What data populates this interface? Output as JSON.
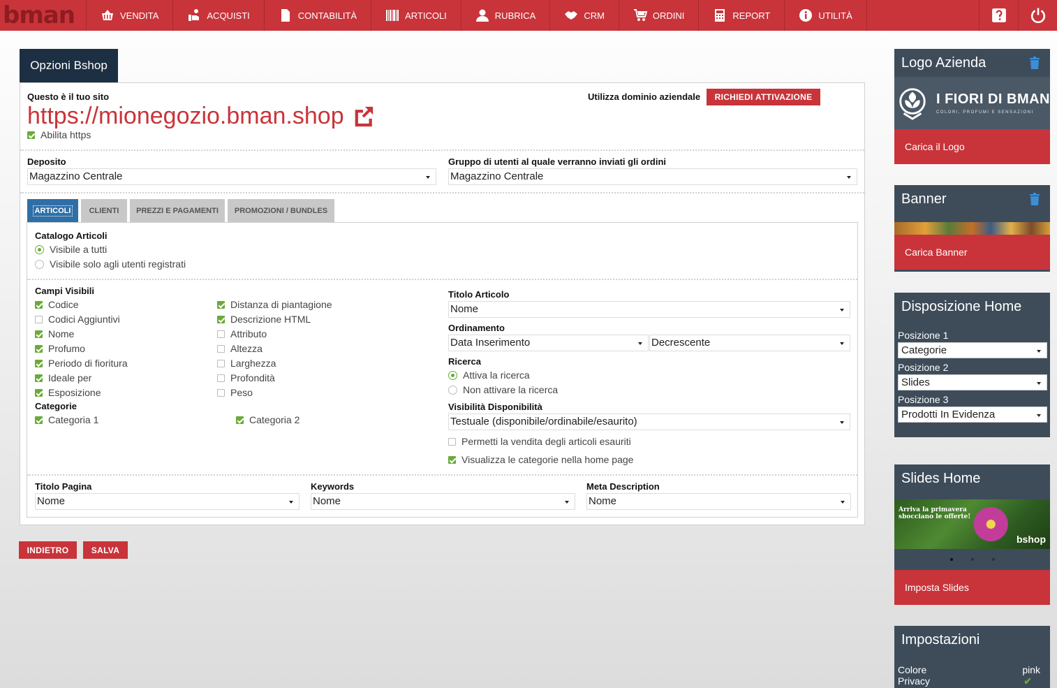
{
  "nav": {
    "logo": "bman",
    "items": [
      {
        "label": "VENDITA",
        "icon": "basket-icon"
      },
      {
        "label": "ACQUISTI",
        "icon": "hand-coin-icon"
      },
      {
        "label": "CONTABILITÀ",
        "icon": "document-icon"
      },
      {
        "label": "ARTICOLI",
        "icon": "barcode-icon"
      },
      {
        "label": "RUBRICA",
        "icon": "user-icon"
      },
      {
        "label": "CRM",
        "icon": "handshake-icon"
      },
      {
        "label": "ORDINI",
        "icon": "cart-icon"
      },
      {
        "label": "REPORT",
        "icon": "calculator-icon"
      },
      {
        "label": "UTILITÀ",
        "icon": "info-icon"
      }
    ]
  },
  "page": {
    "title": "Opzioni Bshop",
    "site_label": "Questo è il tuo sito",
    "site_url": "https://mionegozio.bman.shop",
    "https_label": "Abilita https",
    "https_enabled": true,
    "domain_label": "Utilizza dominio aziendale",
    "domain_button": "RICHIEDI ATTIVAZIONE",
    "deposit_label": "Deposito",
    "deposit_value": "Magazzino Centrale",
    "group_label": "Gruppo di utenti al quale verranno inviati gli ordini",
    "group_value": "Magazzino Centrale"
  },
  "tabs": [
    "ARTICOLI",
    "CLIENTI",
    "PREZZI E PAGAMENTI",
    "PROMOZIONI / BUNDLES"
  ],
  "articoli": {
    "catalog_label": "Catalogo Articoli",
    "catalog_options": [
      "Visibile a tutti",
      "Visibile solo agli utenti registrati"
    ],
    "catalog_selected": 0,
    "fields_label": "Campi Visibili",
    "fields_col1": [
      {
        "label": "Codice",
        "checked": true
      },
      {
        "label": "Codici Aggiuntivi",
        "checked": false
      },
      {
        "label": "Nome",
        "checked": true
      },
      {
        "label": "Profumo",
        "checked": true
      },
      {
        "label": "Periodo di fioritura",
        "checked": true
      },
      {
        "label": "Ideale per",
        "checked": true
      },
      {
        "label": "Esposizione",
        "checked": true
      }
    ],
    "fields_col2": [
      {
        "label": "Distanza di piantagione",
        "checked": true
      },
      {
        "label": "Descrizione HTML",
        "checked": true
      },
      {
        "label": "Attributo",
        "checked": false
      },
      {
        "label": "Altezza",
        "checked": false
      },
      {
        "label": "Larghezza",
        "checked": false
      },
      {
        "label": "Profondità",
        "checked": false
      },
      {
        "label": "Peso",
        "checked": false
      }
    ],
    "categories_label": "Categorie",
    "categories": [
      {
        "label": "Categoria 1",
        "checked": true
      },
      {
        "label": "Categoria 2",
        "checked": true
      }
    ],
    "title_label": "Titolo Articolo",
    "title_value": "Nome",
    "order_label": "Ordinamento",
    "order_field": "Data Inserimento",
    "order_dir": "Decrescente",
    "search_label": "Ricerca",
    "search_options": [
      "Attiva la ricerca",
      "Non attivare la ricerca"
    ],
    "search_selected": 0,
    "availability_label": "Visibilità Disponibilità",
    "availability_value": "Testuale (disponibile/ordinabile/esaurito)",
    "sell_out_label": "Permetti la vendita degli articoli esauriti",
    "sell_out_checked": false,
    "show_cats_label": "Visualizza le categorie nella home page",
    "show_cats_checked": true,
    "page_title_label": "Titolo Pagina",
    "page_title_value": "Nome",
    "keywords_label": "Keywords",
    "keywords_value": "Nome",
    "meta_label": "Meta Description",
    "meta_value": "Nome"
  },
  "buttons": {
    "back": "INDIETRO",
    "save": "SALVA"
  },
  "sidebar": {
    "logo": {
      "title": "Logo Azienda",
      "brand": "I FIORI DI BMAN",
      "tagline": "COLORI, PROFUMI E SENSAZIONI",
      "button": "Carica il Logo"
    },
    "banner": {
      "title": "Banner",
      "button": "Carica Banner"
    },
    "home": {
      "title": "Disposizione Home",
      "positions": [
        {
          "label": "Posizione 1",
          "value": "Categorie"
        },
        {
          "label": "Posizione 2",
          "value": "Slides"
        },
        {
          "label": "Posizione 3",
          "value": "Prodotti In Evidenza"
        }
      ]
    },
    "slides": {
      "title": "Slides Home",
      "caption_line1": "Arriva la primavera",
      "caption_line2": "sbocciano le offerte!",
      "brand": "bshop",
      "button": "Imposta Slides"
    },
    "settings": {
      "title": "Impostazioni",
      "color_label": "Colore",
      "color_value": "pink",
      "privacy_label": "Privacy"
    }
  },
  "colors": {
    "brand_red": "#c8343a",
    "navy": "#1d2f42",
    "slate": "#3e4c5a",
    "green": "#6aaa3a",
    "tab_blue": "#2f6fa8"
  }
}
